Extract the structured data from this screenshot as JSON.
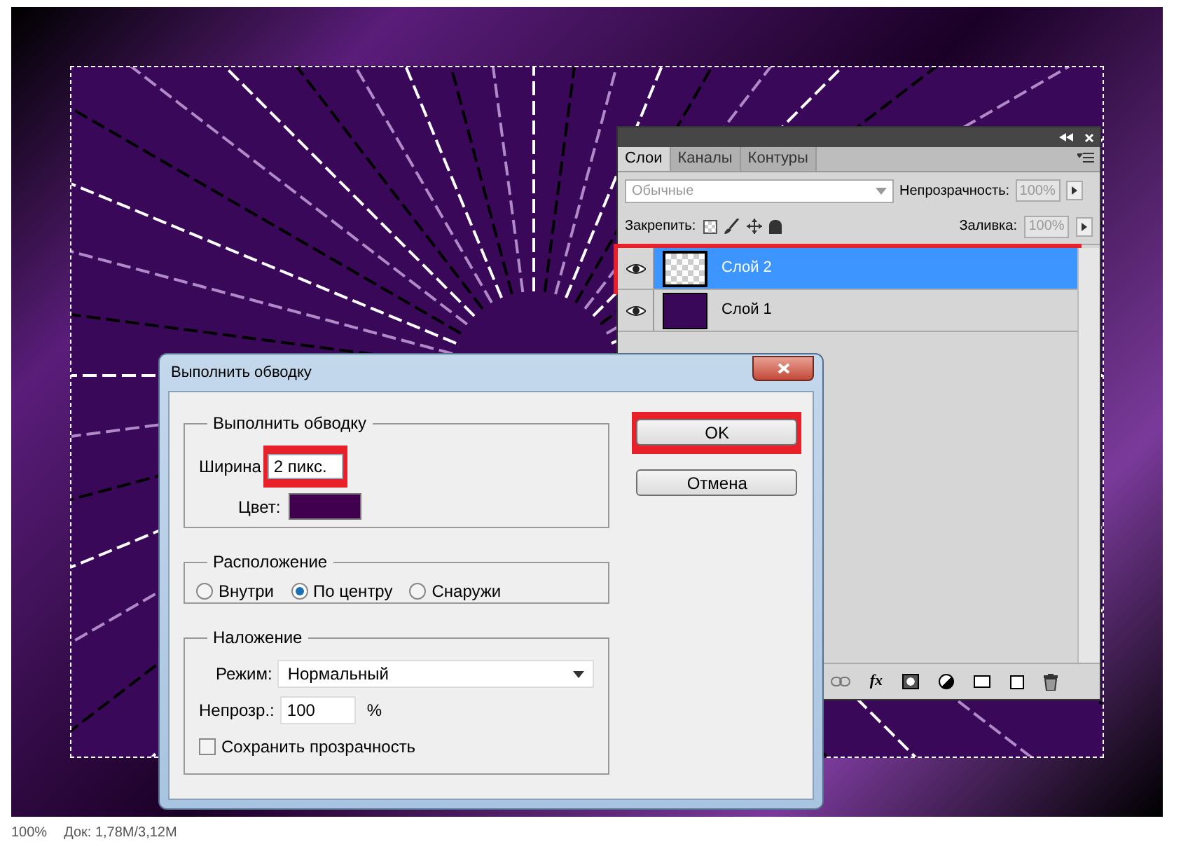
{
  "layers_panel": {
    "tabs": [
      {
        "label": "Слои",
        "selected": true
      },
      {
        "label": "Каналы",
        "selected": false
      },
      {
        "label": "Контуры",
        "selected": false
      }
    ],
    "fx_button": "fx",
    "blend_mode": "Обычные",
    "opacity_label": "Непрозрачность:",
    "opacity": "100%",
    "lock_label": "Закрепить:",
    "fill_label": "Заливка:",
    "fill": "100%",
    "layers": [
      {
        "name": "Слой 2",
        "selected": true,
        "visible": true,
        "highlighted": true,
        "kind": "transparent"
      },
      {
        "name": "Слой 1",
        "selected": false,
        "visible": true,
        "highlighted": false,
        "kind": "image"
      }
    ]
  },
  "dialog": {
    "title": "Выполнить обводку",
    "stroke_group": {
      "legend": "Выполнить обводку",
      "width_label": "Ширина",
      "width": "2 пикс.",
      "width_highlighted": true,
      "color_label": "Цвет:",
      "color": "#40004f"
    },
    "location_group": {
      "legend": "Расположение",
      "options": [
        {
          "label": "Внутри",
          "selected": false
        },
        {
          "label": "По центру",
          "selected": true
        },
        {
          "label": "Снаружи",
          "selected": false
        }
      ]
    },
    "blending_group": {
      "legend": "Наложение",
      "mode_label": "Режим:",
      "mode": "Нормальный",
      "opacity_label": "Непрозр.:",
      "opacity": "100",
      "opacity_unit": "%",
      "preserve_label": "Сохранить прозрачность",
      "preserve_checked": false
    },
    "buttons": [
      {
        "label": "OK",
        "highlighted": true
      },
      {
        "label": "Отмена",
        "highlighted": false
      }
    ]
  },
  "status_bar": {
    "zoom": "100%",
    "doc_size": "Док: 1,78M/3,12M"
  }
}
